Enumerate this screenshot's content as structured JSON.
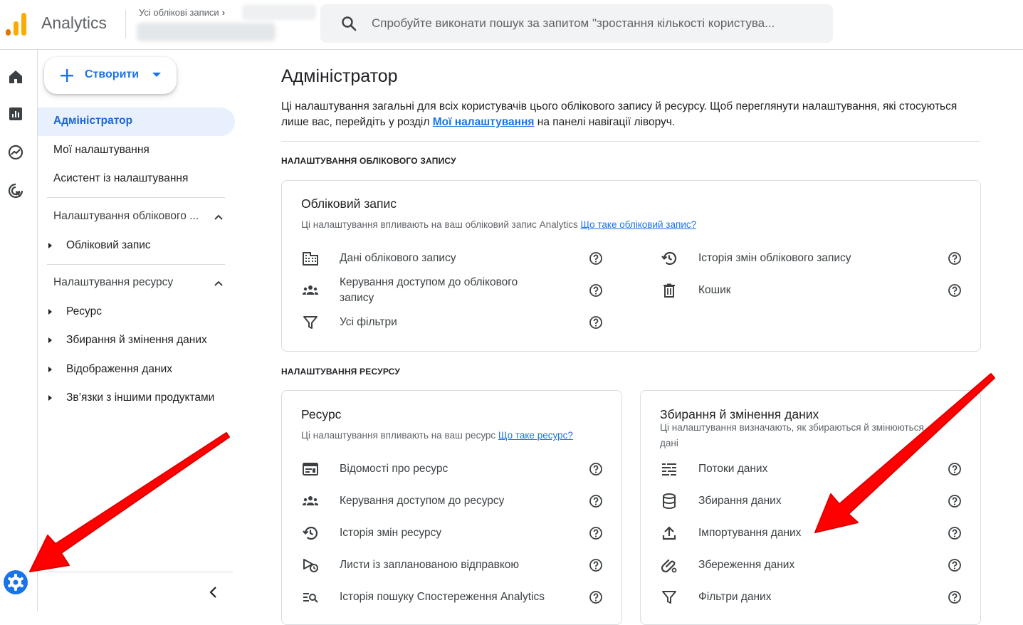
{
  "header": {
    "app_name": "Analytics",
    "breadcrumb": "Усі облікові записи",
    "search_placeholder": "Спробуйте виконати пошук за запитом \"зростання кількості користува..."
  },
  "sidebar": {
    "create_label": "Створити",
    "items": {
      "admin": "Адміністратор",
      "my_settings": "Мої налаштування",
      "setup_assistant": "Асистент із налаштування",
      "account_settings": "Налаштування облікового ...",
      "account": "Обліковий запис",
      "property_settings": "Налаштування ресурсу",
      "property": "Ресурс",
      "data_collection": "Збирання й змінення даних",
      "data_display": "Відображення даних",
      "product_links": "Зв’язки з іншими продуктами"
    }
  },
  "main": {
    "title": "Адміністратор",
    "desc_before": "Ці налаштування загальні для всіх користувачів цього облікового запису й ресурсу. Щоб переглянути налаштування, які стосуються лише вас, перейдіть у розділ ",
    "desc_link": "Мої налаштування",
    "desc_after": " на панелі навігації ліворуч.",
    "account_section": "НАЛАШТУВАННЯ ОБЛІКОВОГО ЗАПИСУ",
    "property_section": "НАЛАШТУВАННЯ РЕСУРСУ"
  },
  "account_card": {
    "title": "Обліковий запис",
    "desc": "Ці налаштування впливають на ваш обліковий запис Analytics ",
    "desc_link": "Що таке обліковий запис?",
    "rows": {
      "details": "Дані облікового запису",
      "access": "Керування доступом до облікового запису",
      "filters": "Усі фільтри",
      "history": "Історія змін облікового запису",
      "trash": "Кошик"
    }
  },
  "property_card": {
    "title": "Ресурс",
    "desc": "Ці налаштування впливають на ваш ресурс ",
    "desc_link": "Що таке ресурс?",
    "rows": {
      "details": "Відомості про ресурс",
      "access": "Керування доступом до ресурсу",
      "history": "Історія змін ресурсу",
      "scheduled": "Листи із запланованою відправкою",
      "search_history": "Історія пошуку Спостереження Analytics"
    }
  },
  "data_card": {
    "title": "Збирання й змінення даних",
    "desc": "Ці налаштування визначають, як збираються й змінюються дані",
    "rows": {
      "streams": "Потоки даних",
      "collection": "Збирання даних",
      "import": "Імпортування даних",
      "retention": "Збереження даних",
      "filters": "Фільтри даних"
    }
  },
  "colors": {
    "accent": "#1a73e8",
    "active_bg": "#e8f0fe",
    "arrow": "#ff0000"
  }
}
